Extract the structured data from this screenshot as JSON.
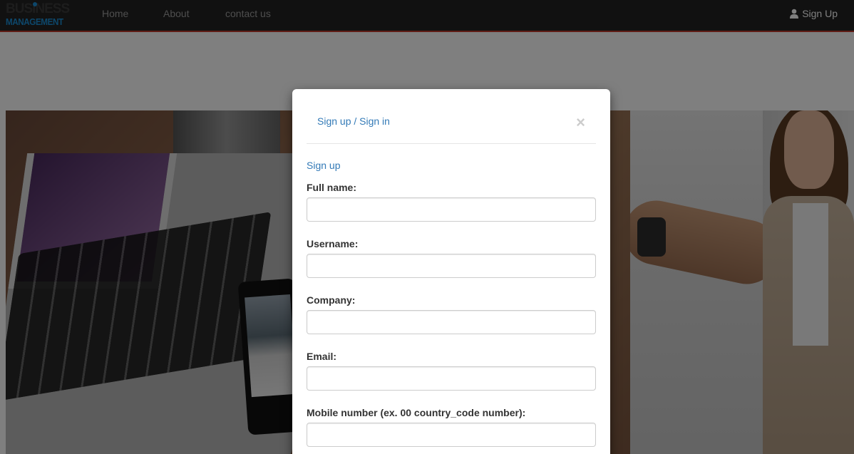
{
  "navbar": {
    "logo_top": "BUSINESS",
    "logo_bottom": "MANAGEMENT",
    "links": [
      "Home",
      "About",
      "contact us"
    ],
    "signup_label": "Sign Up",
    "accent_color": "#c0392b"
  },
  "modal": {
    "title": "Sign up / Sign in",
    "close_glyph": "×",
    "section_title": "Sign up",
    "fields": [
      {
        "label": "Full name:",
        "value": ""
      },
      {
        "label": "Username:",
        "value": ""
      },
      {
        "label": "Company:",
        "value": ""
      },
      {
        "label": "Email:",
        "value": ""
      },
      {
        "label": "Mobile number (ex. 00 country_code number):",
        "value": ""
      }
    ]
  }
}
